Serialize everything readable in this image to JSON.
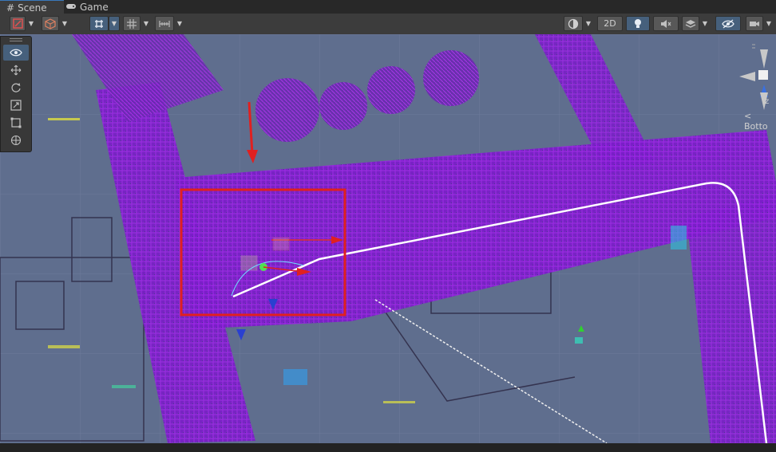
{
  "tabs": [
    {
      "label": "Scene",
      "icon": "hash-icon",
      "active": true
    },
    {
      "label": "Game",
      "icon": "gamepad-icon",
      "active": false
    }
  ],
  "toolbar": {
    "mode_2d_label": "2D"
  },
  "tools": [
    "view-tool",
    "move-tool",
    "rotate-tool",
    "scale-tool",
    "rect-tool",
    "transform-tool"
  ],
  "gizmo": {
    "axis_label": "z",
    "view_label": "< Botto"
  },
  "colors": {
    "viewport_bg": "#5f6e8e",
    "point_cloud": "#8a1fd0",
    "path_line": "#ffffff",
    "selection_box": "#e02020",
    "accent_blue": "#46607c"
  }
}
